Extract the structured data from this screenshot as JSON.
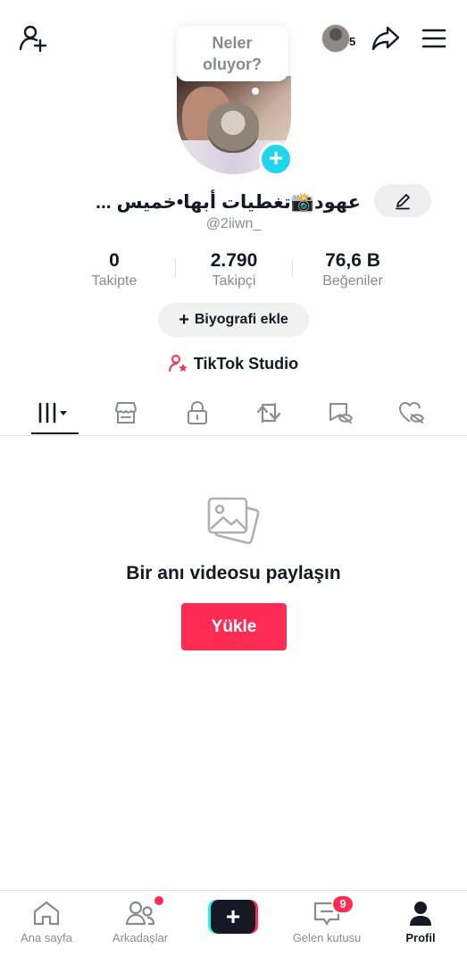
{
  "top_bar": {
    "status_bubble": [
      "Neler",
      "oluyor?"
    ],
    "story_count": "5"
  },
  "profile": {
    "display_name": "... عهود📸تغطيات أبها•خميس",
    "username": "@2iiwn_"
  },
  "stats": {
    "following": {
      "value": "0",
      "label": "Takipte"
    },
    "followers": {
      "value": "2.790",
      "label": "Takipçi"
    },
    "likes": {
      "value": "76,6 B",
      "label": "Beğeniler"
    }
  },
  "bio_button": {
    "label": "Biyografi ekle"
  },
  "studio_link": {
    "label": "TikTok Studio"
  },
  "tabs": [
    {
      "icon": "grid-icon",
      "active": true
    },
    {
      "icon": "shop-icon"
    },
    {
      "icon": "lock-icon"
    },
    {
      "icon": "repost-icon"
    },
    {
      "icon": "tagged-icon"
    },
    {
      "icon": "liked-icon"
    }
  ],
  "empty_state": {
    "title": "Bir anı videosu paylaşın",
    "upload_label": "Yükle"
  },
  "bottom_nav": {
    "home": "Ana sayfa",
    "friends": "Arkadaşlar",
    "inbox": "Gelen kutusu",
    "inbox_badge": "9",
    "profile": "Profil"
  },
  "colors": {
    "accent": "#fe2c55",
    "cyan": "#25f4ee",
    "text": "#161823",
    "muted": "#8a8b91"
  }
}
